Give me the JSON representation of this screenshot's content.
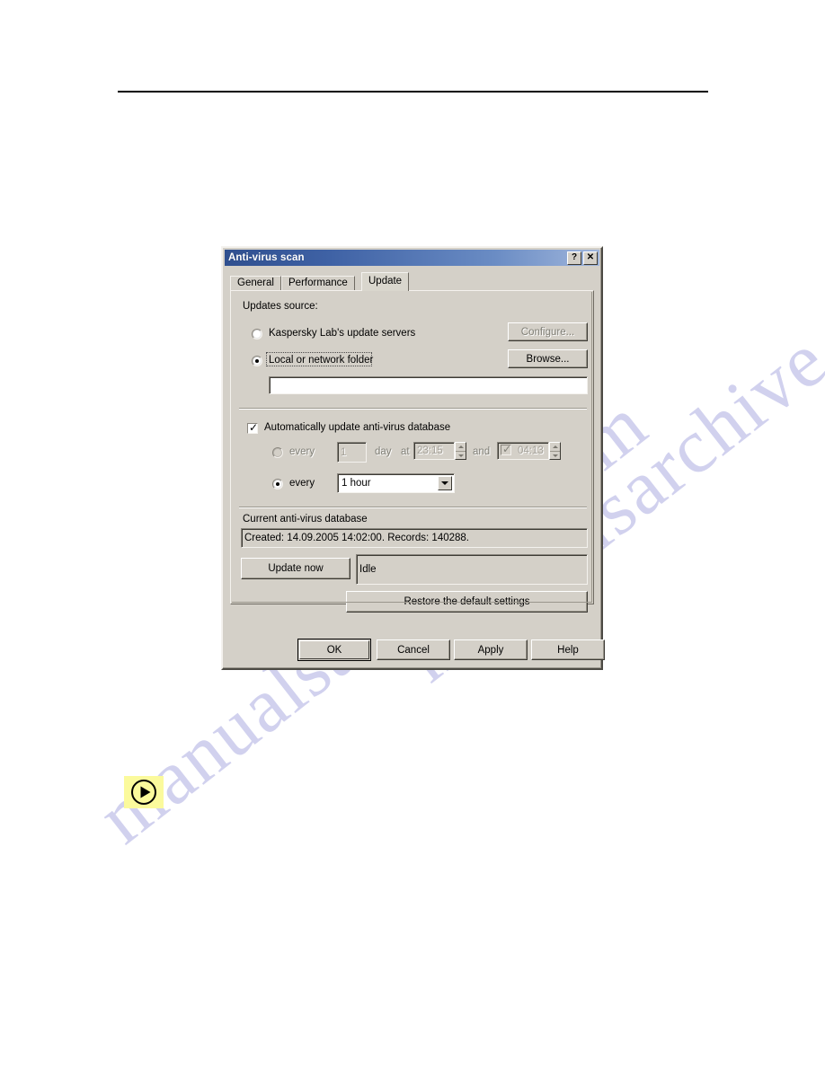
{
  "page": {
    "watermark_text": "manualsarchive.com"
  },
  "dialog": {
    "title": "Anti-virus scan",
    "titlebar_buttons": [
      {
        "name": "help",
        "glyph": "?"
      },
      {
        "name": "close",
        "glyph": "✕"
      }
    ],
    "tabs": [
      {
        "label": "General",
        "active": false
      },
      {
        "label": "Performance",
        "active": false
      },
      {
        "label": "Update",
        "active": true
      }
    ],
    "update_tab": {
      "updates_source": {
        "group_label": "Updates source:",
        "options": [
          {
            "label": "Kaspersky Lab's update servers",
            "selected": false
          },
          {
            "label": "Local or network folder",
            "selected": true,
            "focused": true
          }
        ],
        "configure_button": {
          "label": "Configure...",
          "enabled": false
        },
        "browse_button": {
          "label": "Browse...",
          "enabled": true
        },
        "folder_path_input": {
          "value": "",
          "placeholder": ""
        }
      },
      "auto_update": {
        "checkbox_label": "Automatically update anti-virus database",
        "checked": true,
        "schedule_daily": {
          "radio_label": "every",
          "selected": false,
          "enabled": false,
          "interval_value": "1",
          "unit_label": "day",
          "at_label": "at",
          "first_time": "23:15",
          "and_label": "and",
          "second_time_enabled_checkbox": true,
          "second_time": "04:13"
        },
        "schedule_interval": {
          "radio_label": "every",
          "selected": true,
          "enabled": true,
          "value": "1 hour",
          "options": [
            "1 hour"
          ]
        }
      },
      "current_database": {
        "group_label": "Current anti-virus database",
        "info": "Created: 14.09.2005 14:02:00. Records: 140288."
      },
      "update_now_button": {
        "label": "Update now"
      },
      "update_status": {
        "value": "Idle"
      },
      "restore_defaults_button": {
        "label": "Restore the default settings"
      }
    },
    "footer_buttons": [
      {
        "label": "OK",
        "default": true
      },
      {
        "label": "Cancel",
        "default": false
      },
      {
        "label": "Apply",
        "default": false,
        "mnemonic": "A"
      },
      {
        "label": "Help",
        "default": false
      }
    ]
  }
}
